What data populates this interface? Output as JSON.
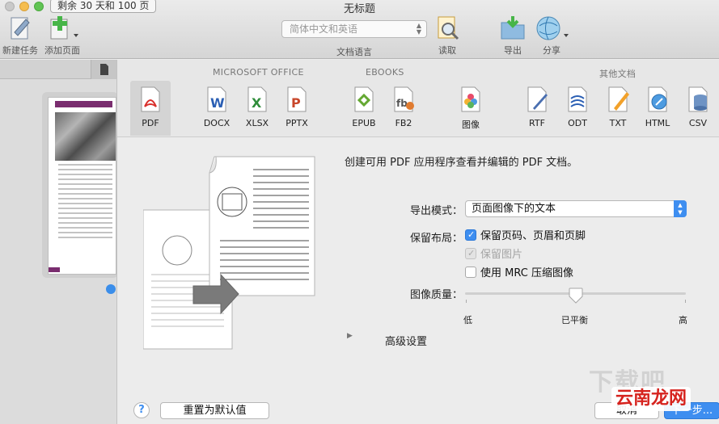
{
  "window": {
    "title": "无标题",
    "trial_badge": "剩余 30 天和 100 页"
  },
  "toolbar": {
    "new_task": "新建任务",
    "add_page": "添加页面",
    "language_value": "简体中文和英语",
    "language_label": "文档语言",
    "read": "读取",
    "export": "导出",
    "share": "分享"
  },
  "format_groups": {
    "office": "MICROSOFT OFFICE",
    "ebooks": "EBOOKS",
    "other": "其他文档"
  },
  "formats": {
    "pdf": "PDF",
    "docx": "DOCX",
    "xlsx": "XLSX",
    "pptx": "PPTX",
    "epub": "EPUB",
    "fb2": "FB2",
    "image": "图像",
    "rtf": "RTF",
    "odt": "ODT",
    "txt": "TXT",
    "html": "HTML",
    "csv": "CSV"
  },
  "selected_format": "PDF",
  "description": "创建可用 PDF 应用程序查看并编辑的 PDF 文档。",
  "options": {
    "export_mode_label": "导出模式：",
    "export_mode_value": "页面图像下的文本",
    "layout_label": "保留布局：",
    "keep_page_numbers": "保留页码、页眉和页脚",
    "keep_page_numbers_checked": true,
    "keep_images": "保留图片",
    "keep_images_checked": true,
    "keep_images_disabled": true,
    "use_mrc": "使用 MRC 压缩图像",
    "use_mrc_checked": false,
    "quality_label": "图像质量：",
    "quality_low": "低",
    "quality_mid": "已平衡",
    "quality_high": "高",
    "quality_level": 0.5
  },
  "advanced": "高级设置",
  "buttons": {
    "help": "?",
    "reset": "重置为默认值",
    "cancel": "取消",
    "next": "下一步..."
  },
  "watermarks": {
    "site": "下载吧",
    "brand": "云南龙网"
  },
  "colors": {
    "accent": "#3e8ef0",
    "thumb_header": "#7a2d6f"
  }
}
